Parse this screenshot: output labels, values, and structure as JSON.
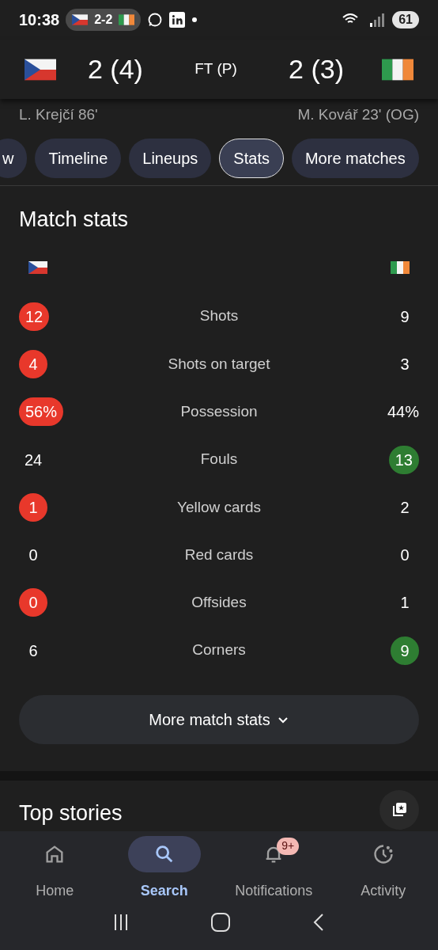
{
  "status_bar": {
    "time": "10:38",
    "live_chip": {
      "score": "2-2"
    },
    "battery": "61"
  },
  "match": {
    "home": {
      "score": "2 (4)",
      "scorer": "L. Krejčí 86'",
      "color": "#e8382b"
    },
    "status": "FT (P)",
    "away": {
      "score": "2 (3)",
      "scorer": "M. Kovář 23' (OG)",
      "color": "#2e7d32"
    }
  },
  "tabs": [
    {
      "label": "w",
      "selected": false
    },
    {
      "label": "Timeline",
      "selected": false
    },
    {
      "label": "Lineups",
      "selected": false
    },
    {
      "label": "Stats",
      "selected": true
    },
    {
      "label": "More matches",
      "selected": false
    }
  ],
  "match_stats": {
    "title": "Match stats",
    "rows": [
      {
        "label": "Shots",
        "home": "12",
        "away": "9",
        "home_highlight": true,
        "away_highlight": false
      },
      {
        "label": "Shots on target",
        "home": "4",
        "away": "3",
        "home_highlight": true,
        "away_highlight": false
      },
      {
        "label": "Possession",
        "home": "56%",
        "away": "44%",
        "home_highlight": true,
        "away_highlight": false
      },
      {
        "label": "Fouls",
        "home": "24",
        "away": "13",
        "home_highlight": false,
        "away_highlight": true
      },
      {
        "label": "Yellow cards",
        "home": "1",
        "away": "2",
        "home_highlight": true,
        "away_highlight": false
      },
      {
        "label": "Red cards",
        "home": "0",
        "away": "0",
        "home_highlight": false,
        "away_highlight": false
      },
      {
        "label": "Offsides",
        "home": "0",
        "away": "1",
        "home_highlight": true,
        "away_highlight": false
      },
      {
        "label": "Corners",
        "home": "6",
        "away": "9",
        "home_highlight": false,
        "away_highlight": true
      }
    ],
    "more_button": "More match stats"
  },
  "top_stories": {
    "title": "Top stories"
  },
  "bottom_nav": [
    {
      "label": "Home",
      "selected": false
    },
    {
      "label": "Search",
      "selected": true
    },
    {
      "label": "Notifications",
      "selected": false,
      "badge": "9+"
    },
    {
      "label": "Activity",
      "selected": false
    }
  ]
}
